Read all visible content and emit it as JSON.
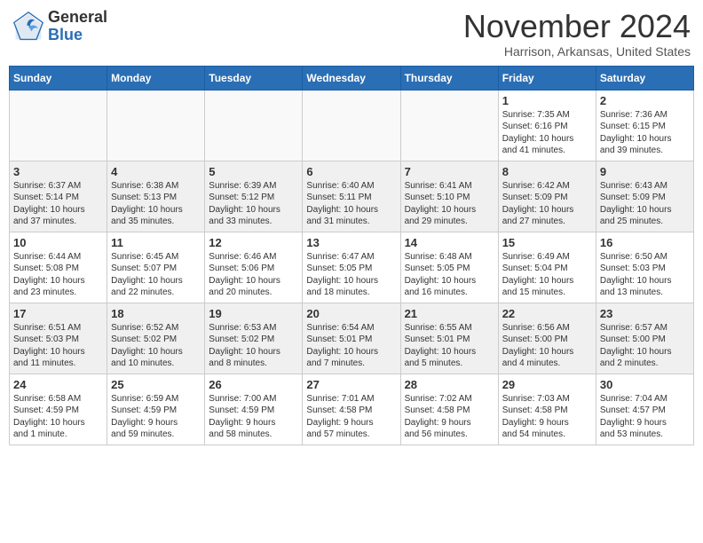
{
  "header": {
    "logo_general": "General",
    "logo_blue": "Blue",
    "month_title": "November 2024",
    "location": "Harrison, Arkansas, United States"
  },
  "weekdays": [
    "Sunday",
    "Monday",
    "Tuesday",
    "Wednesday",
    "Thursday",
    "Friday",
    "Saturday"
  ],
  "weeks": [
    [
      {
        "day": "",
        "info": ""
      },
      {
        "day": "",
        "info": ""
      },
      {
        "day": "",
        "info": ""
      },
      {
        "day": "",
        "info": ""
      },
      {
        "day": "",
        "info": ""
      },
      {
        "day": "1",
        "info": "Sunrise: 7:35 AM\nSunset: 6:16 PM\nDaylight: 10 hours\nand 41 minutes."
      },
      {
        "day": "2",
        "info": "Sunrise: 7:36 AM\nSunset: 6:15 PM\nDaylight: 10 hours\nand 39 minutes."
      }
    ],
    [
      {
        "day": "3",
        "info": "Sunrise: 6:37 AM\nSunset: 5:14 PM\nDaylight: 10 hours\nand 37 minutes."
      },
      {
        "day": "4",
        "info": "Sunrise: 6:38 AM\nSunset: 5:13 PM\nDaylight: 10 hours\nand 35 minutes."
      },
      {
        "day": "5",
        "info": "Sunrise: 6:39 AM\nSunset: 5:12 PM\nDaylight: 10 hours\nand 33 minutes."
      },
      {
        "day": "6",
        "info": "Sunrise: 6:40 AM\nSunset: 5:11 PM\nDaylight: 10 hours\nand 31 minutes."
      },
      {
        "day": "7",
        "info": "Sunrise: 6:41 AM\nSunset: 5:10 PM\nDaylight: 10 hours\nand 29 minutes."
      },
      {
        "day": "8",
        "info": "Sunrise: 6:42 AM\nSunset: 5:09 PM\nDaylight: 10 hours\nand 27 minutes."
      },
      {
        "day": "9",
        "info": "Sunrise: 6:43 AM\nSunset: 5:09 PM\nDaylight: 10 hours\nand 25 minutes."
      }
    ],
    [
      {
        "day": "10",
        "info": "Sunrise: 6:44 AM\nSunset: 5:08 PM\nDaylight: 10 hours\nand 23 minutes."
      },
      {
        "day": "11",
        "info": "Sunrise: 6:45 AM\nSunset: 5:07 PM\nDaylight: 10 hours\nand 22 minutes."
      },
      {
        "day": "12",
        "info": "Sunrise: 6:46 AM\nSunset: 5:06 PM\nDaylight: 10 hours\nand 20 minutes."
      },
      {
        "day": "13",
        "info": "Sunrise: 6:47 AM\nSunset: 5:05 PM\nDaylight: 10 hours\nand 18 minutes."
      },
      {
        "day": "14",
        "info": "Sunrise: 6:48 AM\nSunset: 5:05 PM\nDaylight: 10 hours\nand 16 minutes."
      },
      {
        "day": "15",
        "info": "Sunrise: 6:49 AM\nSunset: 5:04 PM\nDaylight: 10 hours\nand 15 minutes."
      },
      {
        "day": "16",
        "info": "Sunrise: 6:50 AM\nSunset: 5:03 PM\nDaylight: 10 hours\nand 13 minutes."
      }
    ],
    [
      {
        "day": "17",
        "info": "Sunrise: 6:51 AM\nSunset: 5:03 PM\nDaylight: 10 hours\nand 11 minutes."
      },
      {
        "day": "18",
        "info": "Sunrise: 6:52 AM\nSunset: 5:02 PM\nDaylight: 10 hours\nand 10 minutes."
      },
      {
        "day": "19",
        "info": "Sunrise: 6:53 AM\nSunset: 5:02 PM\nDaylight: 10 hours\nand 8 minutes."
      },
      {
        "day": "20",
        "info": "Sunrise: 6:54 AM\nSunset: 5:01 PM\nDaylight: 10 hours\nand 7 minutes."
      },
      {
        "day": "21",
        "info": "Sunrise: 6:55 AM\nSunset: 5:01 PM\nDaylight: 10 hours\nand 5 minutes."
      },
      {
        "day": "22",
        "info": "Sunrise: 6:56 AM\nSunset: 5:00 PM\nDaylight: 10 hours\nand 4 minutes."
      },
      {
        "day": "23",
        "info": "Sunrise: 6:57 AM\nSunset: 5:00 PM\nDaylight: 10 hours\nand 2 minutes."
      }
    ],
    [
      {
        "day": "24",
        "info": "Sunrise: 6:58 AM\nSunset: 4:59 PM\nDaylight: 10 hours\nand 1 minute."
      },
      {
        "day": "25",
        "info": "Sunrise: 6:59 AM\nSunset: 4:59 PM\nDaylight: 9 hours\nand 59 minutes."
      },
      {
        "day": "26",
        "info": "Sunrise: 7:00 AM\nSunset: 4:59 PM\nDaylight: 9 hours\nand 58 minutes."
      },
      {
        "day": "27",
        "info": "Sunrise: 7:01 AM\nSunset: 4:58 PM\nDaylight: 9 hours\nand 57 minutes."
      },
      {
        "day": "28",
        "info": "Sunrise: 7:02 AM\nSunset: 4:58 PM\nDaylight: 9 hours\nand 56 minutes."
      },
      {
        "day": "29",
        "info": "Sunrise: 7:03 AM\nSunset: 4:58 PM\nDaylight: 9 hours\nand 54 minutes."
      },
      {
        "day": "30",
        "info": "Sunrise: 7:04 AM\nSunset: 4:57 PM\nDaylight: 9 hours\nand 53 minutes."
      }
    ]
  ]
}
